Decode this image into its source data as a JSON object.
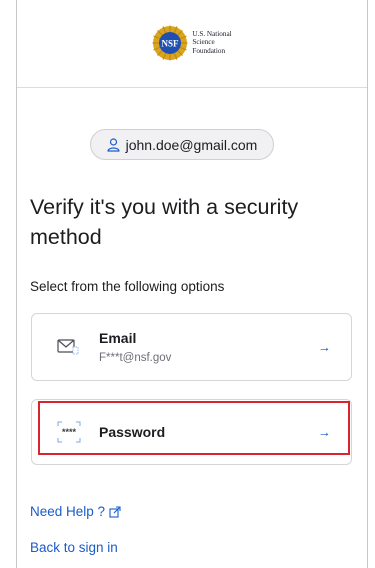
{
  "header": {
    "logo_lines": [
      "U.S. National",
      "Science",
      "Foundation"
    ],
    "seal_text": "NSF"
  },
  "user": {
    "email": "john.doe@gmail.com",
    "icon": "user-icon"
  },
  "title": "Verify it's you with a security method",
  "subtitle": "Select from the following options",
  "options": [
    {
      "label": "Email",
      "detail": "F***t@nsf.gov",
      "icon": "mail-icon"
    },
    {
      "label": "Password",
      "icon": "password-icon",
      "icon_text": "****"
    }
  ],
  "links": {
    "help": "Need Help ?",
    "back": "Back to sign in"
  },
  "colors": {
    "accent": "#1a5cc8",
    "highlight": "#d8242e",
    "seal": "#1f4fb0"
  }
}
